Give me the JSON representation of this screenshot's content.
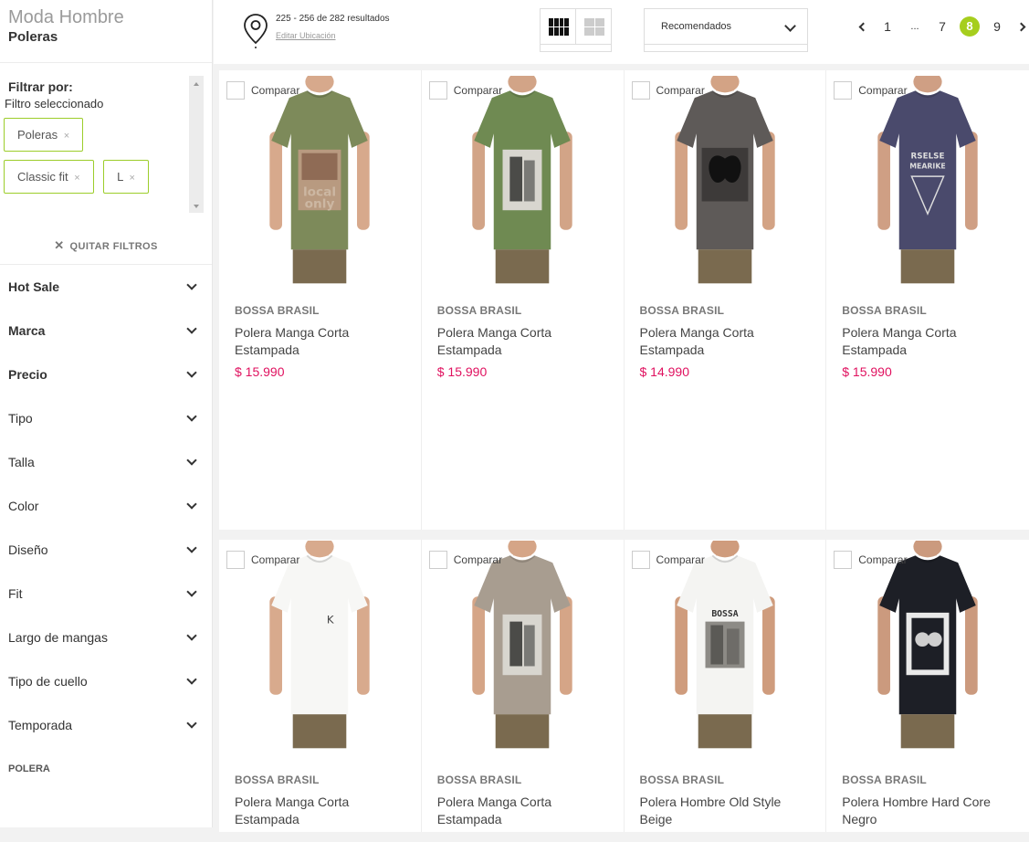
{
  "sidebar": {
    "category_title": "Moda Hombre",
    "category_sub": "Poleras",
    "filter_by": "Filtrar por:",
    "selected_label": "Filtro seleccionado",
    "chips": [
      {
        "label": "Poleras"
      },
      {
        "label": "Classic fit"
      },
      {
        "label": "L"
      }
    ],
    "chip_remove": "×",
    "clear_filters": "QUITAR FILTROS",
    "facets": [
      {
        "label": "Hot Sale",
        "bold": true
      },
      {
        "label": "Marca",
        "bold": true
      },
      {
        "label": "Precio",
        "bold": true
      },
      {
        "label": "Tipo",
        "bold": false
      },
      {
        "label": "Talla",
        "bold": false
      },
      {
        "label": "Color",
        "bold": false
      },
      {
        "label": "Diseño",
        "bold": false
      },
      {
        "label": "Fit",
        "bold": false
      },
      {
        "label": "Largo de mangas",
        "bold": false
      },
      {
        "label": "Tipo de cuello",
        "bold": false
      },
      {
        "label": "Temporada",
        "bold": false
      }
    ],
    "bottom_label": "POLERA"
  },
  "topbar": {
    "results_text": "225 - 256 de 282 resultados",
    "edit_location": "Editar Ubicación",
    "sort_value": "Recomendados",
    "pages": [
      "1",
      "...",
      "7",
      "8",
      "9"
    ],
    "active_page": "8"
  },
  "products": [
    {
      "brand": "BOSSA BRASIL",
      "name": "Polera Manga Corta Estampada",
      "price": "$ 15.990",
      "compare": "Comparar",
      "shirt_color": "#7d8a5a",
      "skin": "#d7a98c",
      "print": "local-only"
    },
    {
      "brand": "BOSSA BRASIL",
      "name": "Polera Manga Corta Estampada",
      "price": "$ 15.990",
      "compare": "Comparar",
      "shirt_color": "#6f8a52",
      "skin": "#d2a487",
      "print": "photo"
    },
    {
      "brand": "BOSSA BRASIL",
      "name": "Polera Manga Corta Estampada",
      "price": "$ 14.990",
      "compare": "Comparar",
      "shirt_color": "#5e5a58",
      "skin": "#d3a385",
      "print": "butterfly"
    },
    {
      "brand": "BOSSA BRASIL",
      "name": "Polera Manga Corta Estampada",
      "price": "$ 15.990",
      "compare": "Comparar",
      "shirt_color": "#4a4a6c",
      "skin": "#cf9f84",
      "print": "text"
    },
    {
      "brand": "BOSSA BRASIL",
      "name": "Polera Manga Corta Estampada",
      "price": "",
      "compare": "Comparar",
      "shirt_color": "#f7f7f5",
      "skin": "#d8aa8d",
      "print": "small"
    },
    {
      "brand": "BOSSA BRASIL",
      "name": "Polera Manga Corta Estampada",
      "price": "",
      "compare": "Comparar",
      "shirt_color": "#a89d90",
      "skin": "#d5a587",
      "print": "photo"
    },
    {
      "brand": "BOSSA BRASIL",
      "name": "Polera Hombre Old Style Beige",
      "price": "",
      "compare": "Comparar",
      "shirt_color": "#f4f4f2",
      "skin": "#cf9c7d",
      "print": "oldstyle"
    },
    {
      "brand": "BOSSA BRASIL",
      "name": "Polera Hombre Hard Core Negro",
      "price": "",
      "compare": "Comparar",
      "shirt_color": "#1d1f26",
      "skin": "#cb9a7e",
      "print": "hardcore"
    }
  ],
  "colors": {
    "accent": "#a6ce1e",
    "price": "#e0115f",
    "chip_border": "#9ccd2a"
  }
}
